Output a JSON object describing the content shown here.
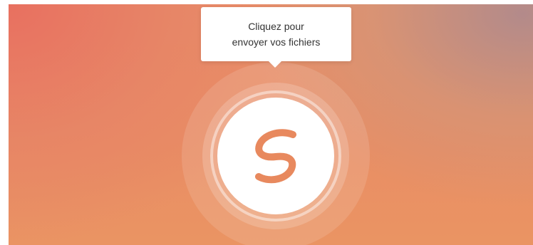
{
  "tooltip": {
    "line1": "Cliquez pour",
    "line2": "envoyer vos fichiers"
  },
  "upload": {
    "icon": "swisstransfer-logo-icon"
  },
  "colors": {
    "accent": "#e8895e",
    "gradient_top_left": "#e8705f",
    "gradient_top_right": "#b08a8c",
    "gradient_bottom": "#ea9463",
    "tooltip_background": "#ffffff",
    "tooltip_text": "#333333"
  }
}
